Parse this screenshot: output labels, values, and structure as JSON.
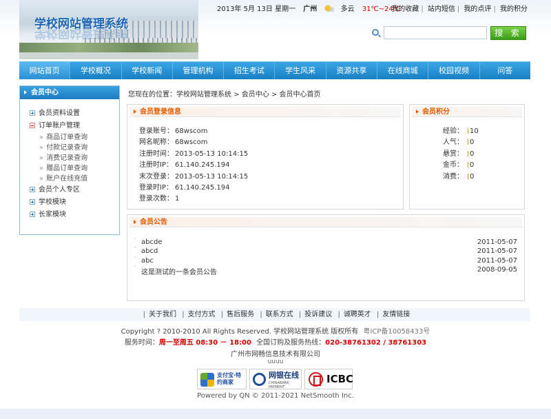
{
  "header": {
    "site_title": "学校网站管理系统",
    "date": "2013年 5月 13日 星期一",
    "city": "广州",
    "weather": "多云",
    "temperature": "31℃~24℃",
    "weather_icon": "partly-cloudy-icon",
    "top_links": [
      "我的收藏",
      "站内短信",
      "我的点评",
      "我的积分"
    ],
    "search": {
      "value": "",
      "placeholder": "",
      "button_label": "搜 索"
    }
  },
  "nav": {
    "items": [
      "网站首页",
      "学校概况",
      "学校新闻",
      "管理机构",
      "招生考试",
      "学生风采",
      "资源共享",
      "在线商城",
      "校园视频",
      "问答"
    ],
    "active_index": 0
  },
  "sidebar": {
    "title": "会员中心",
    "items": [
      {
        "label": "会员资料设置",
        "state": "plus"
      },
      {
        "label": "订单账户管理",
        "state": "minus"
      },
      {
        "label": "会员个人专区",
        "state": "plus"
      },
      {
        "label": "学校模块",
        "state": "plus"
      },
      {
        "label": "长家模块",
        "state": "plus"
      }
    ],
    "sub_items": [
      "商品订单查询",
      "付款记录查询",
      "消费记录查询",
      "赠品订单查询",
      "账户在线充值"
    ]
  },
  "breadcrumb": "您现在的位置：学校网站管理系统 > 会员中心 > 会员中心首页",
  "login_panel": {
    "title": "会员登录信息",
    "rows": [
      {
        "label": "登录账号：",
        "value": "68wscom"
      },
      {
        "label": "网名昵称：",
        "value": "68wscom"
      },
      {
        "label": "注册时间：",
        "value": "2013-05-13 10:14:15"
      },
      {
        "label": "注册时IP：",
        "value": "61.140.245.194"
      },
      {
        "label": "末次登录：",
        "value": "2013-05-13 10:14:15"
      },
      {
        "label": "登录时IP：",
        "value": "61.140.245.194"
      },
      {
        "label": "登录次数：",
        "value": "1"
      }
    ]
  },
  "points_panel": {
    "title": "会员积分",
    "rows": [
      {
        "label": "经验：",
        "value": "10"
      },
      {
        "label": "人气：",
        "value": "0"
      },
      {
        "label": "悬赏：",
        "value": "0"
      },
      {
        "label": "金币：",
        "value": "0"
      },
      {
        "label": "消费：",
        "value": "0"
      }
    ]
  },
  "notice_panel": {
    "title": "会员公告",
    "items": [
      {
        "title": "abcde",
        "date": "2011-05-07"
      },
      {
        "title": "abcd",
        "date": "2011-05-07"
      },
      {
        "title": "abc",
        "date": "2011-05-07"
      },
      {
        "title": "这是测试的一条会员公告",
        "date": "2008-09-05"
      }
    ]
  },
  "footer": {
    "links": [
      "关于我们",
      "支付方式",
      "售后服务",
      "联系方式",
      "投诉建议",
      "诚聘英才",
      "友情链接"
    ],
    "copyright": "Copyright ? 2010-2010 All Rights Reserved. 学校网站管理系统 版权所有",
    "icp": "粤ICP备10058433号",
    "service_label": "服务时间：",
    "service_time": "周一至周五 08:30 － 18:00",
    "hotline_label": "全国订购及服务热线：",
    "hotline": "020-38761302 / 38761303",
    "company": "广州市网畅信息技术有限公司",
    "small_text": "uuuu",
    "badges": {
      "alipay": "支付宝·特约商家",
      "chinabank": "网银在线",
      "chinabank_sub": "CHINABANK PAYMENT",
      "icbc": "ICBC"
    },
    "powered": "Powered by QN © 2011-2021 NetSmooth Inc."
  }
}
